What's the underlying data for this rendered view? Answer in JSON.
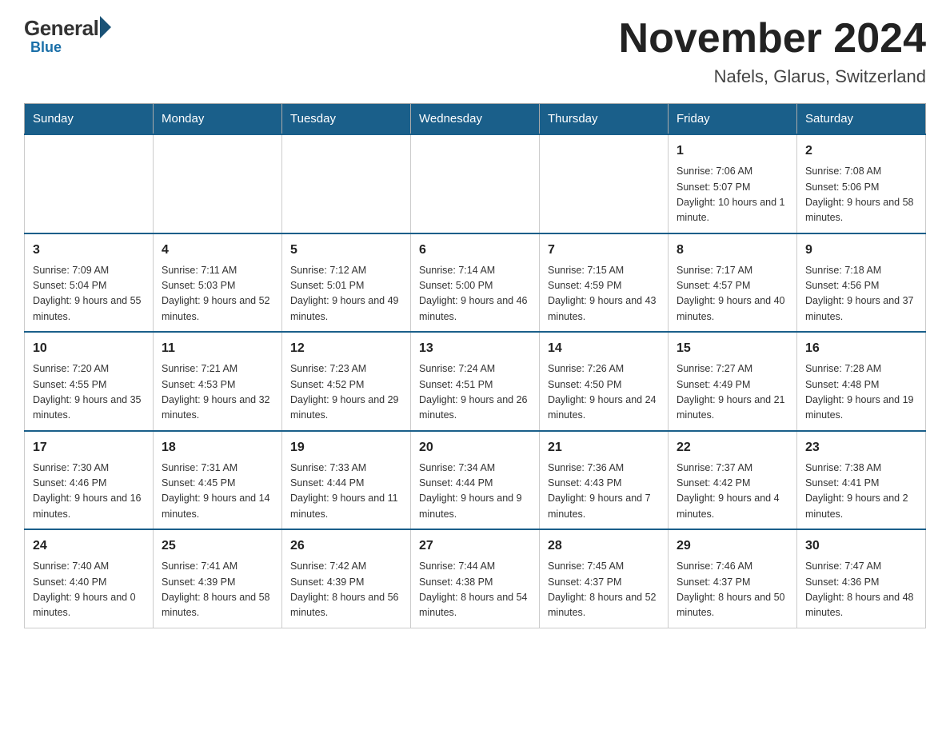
{
  "header": {
    "logo_general": "General",
    "logo_blue": "Blue",
    "month_title": "November 2024",
    "location": "Nafels, Glarus, Switzerland"
  },
  "days_of_week": [
    "Sunday",
    "Monday",
    "Tuesday",
    "Wednesday",
    "Thursday",
    "Friday",
    "Saturday"
  ],
  "weeks": [
    [
      {
        "day": "",
        "info": ""
      },
      {
        "day": "",
        "info": ""
      },
      {
        "day": "",
        "info": ""
      },
      {
        "day": "",
        "info": ""
      },
      {
        "day": "",
        "info": ""
      },
      {
        "day": "1",
        "info": "Sunrise: 7:06 AM\nSunset: 5:07 PM\nDaylight: 10 hours and 1 minute."
      },
      {
        "day": "2",
        "info": "Sunrise: 7:08 AM\nSunset: 5:06 PM\nDaylight: 9 hours and 58 minutes."
      }
    ],
    [
      {
        "day": "3",
        "info": "Sunrise: 7:09 AM\nSunset: 5:04 PM\nDaylight: 9 hours and 55 minutes."
      },
      {
        "day": "4",
        "info": "Sunrise: 7:11 AM\nSunset: 5:03 PM\nDaylight: 9 hours and 52 minutes."
      },
      {
        "day": "5",
        "info": "Sunrise: 7:12 AM\nSunset: 5:01 PM\nDaylight: 9 hours and 49 minutes."
      },
      {
        "day": "6",
        "info": "Sunrise: 7:14 AM\nSunset: 5:00 PM\nDaylight: 9 hours and 46 minutes."
      },
      {
        "day": "7",
        "info": "Sunrise: 7:15 AM\nSunset: 4:59 PM\nDaylight: 9 hours and 43 minutes."
      },
      {
        "day": "8",
        "info": "Sunrise: 7:17 AM\nSunset: 4:57 PM\nDaylight: 9 hours and 40 minutes."
      },
      {
        "day": "9",
        "info": "Sunrise: 7:18 AM\nSunset: 4:56 PM\nDaylight: 9 hours and 37 minutes."
      }
    ],
    [
      {
        "day": "10",
        "info": "Sunrise: 7:20 AM\nSunset: 4:55 PM\nDaylight: 9 hours and 35 minutes."
      },
      {
        "day": "11",
        "info": "Sunrise: 7:21 AM\nSunset: 4:53 PM\nDaylight: 9 hours and 32 minutes."
      },
      {
        "day": "12",
        "info": "Sunrise: 7:23 AM\nSunset: 4:52 PM\nDaylight: 9 hours and 29 minutes."
      },
      {
        "day": "13",
        "info": "Sunrise: 7:24 AM\nSunset: 4:51 PM\nDaylight: 9 hours and 26 minutes."
      },
      {
        "day": "14",
        "info": "Sunrise: 7:26 AM\nSunset: 4:50 PM\nDaylight: 9 hours and 24 minutes."
      },
      {
        "day": "15",
        "info": "Sunrise: 7:27 AM\nSunset: 4:49 PM\nDaylight: 9 hours and 21 minutes."
      },
      {
        "day": "16",
        "info": "Sunrise: 7:28 AM\nSunset: 4:48 PM\nDaylight: 9 hours and 19 minutes."
      }
    ],
    [
      {
        "day": "17",
        "info": "Sunrise: 7:30 AM\nSunset: 4:46 PM\nDaylight: 9 hours and 16 minutes."
      },
      {
        "day": "18",
        "info": "Sunrise: 7:31 AM\nSunset: 4:45 PM\nDaylight: 9 hours and 14 minutes."
      },
      {
        "day": "19",
        "info": "Sunrise: 7:33 AM\nSunset: 4:44 PM\nDaylight: 9 hours and 11 minutes."
      },
      {
        "day": "20",
        "info": "Sunrise: 7:34 AM\nSunset: 4:44 PM\nDaylight: 9 hours and 9 minutes."
      },
      {
        "day": "21",
        "info": "Sunrise: 7:36 AM\nSunset: 4:43 PM\nDaylight: 9 hours and 7 minutes."
      },
      {
        "day": "22",
        "info": "Sunrise: 7:37 AM\nSunset: 4:42 PM\nDaylight: 9 hours and 4 minutes."
      },
      {
        "day": "23",
        "info": "Sunrise: 7:38 AM\nSunset: 4:41 PM\nDaylight: 9 hours and 2 minutes."
      }
    ],
    [
      {
        "day": "24",
        "info": "Sunrise: 7:40 AM\nSunset: 4:40 PM\nDaylight: 9 hours and 0 minutes."
      },
      {
        "day": "25",
        "info": "Sunrise: 7:41 AM\nSunset: 4:39 PM\nDaylight: 8 hours and 58 minutes."
      },
      {
        "day": "26",
        "info": "Sunrise: 7:42 AM\nSunset: 4:39 PM\nDaylight: 8 hours and 56 minutes."
      },
      {
        "day": "27",
        "info": "Sunrise: 7:44 AM\nSunset: 4:38 PM\nDaylight: 8 hours and 54 minutes."
      },
      {
        "day": "28",
        "info": "Sunrise: 7:45 AM\nSunset: 4:37 PM\nDaylight: 8 hours and 52 minutes."
      },
      {
        "day": "29",
        "info": "Sunrise: 7:46 AM\nSunset: 4:37 PM\nDaylight: 8 hours and 50 minutes."
      },
      {
        "day": "30",
        "info": "Sunrise: 7:47 AM\nSunset: 4:36 PM\nDaylight: 8 hours and 48 minutes."
      }
    ]
  ]
}
